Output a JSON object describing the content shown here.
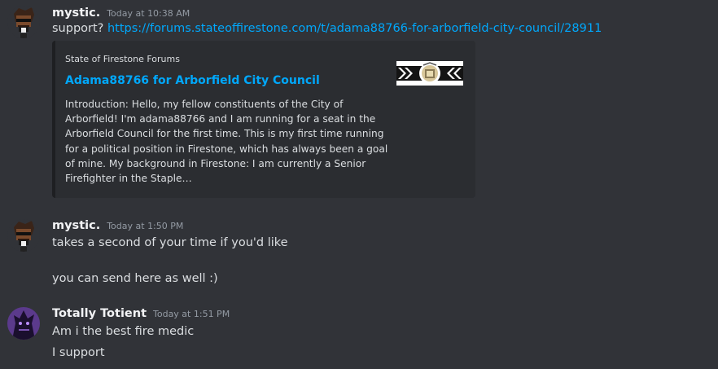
{
  "messages": [
    {
      "username": "mystic.",
      "timestamp": "Today at 10:38 AM",
      "text_prefix": "support?",
      "link": "https://forums.stateoffirestone.com/t/adama88766-for-arborfield-city-council/28911",
      "embed": {
        "provider": "State of Firestone Forums",
        "title": "Adama88766 for Arborfield City Council",
        "description": "Introduction: Hello, my fellow constituents of the City of\nArborfield! I'm adama88766 and I am running for a seat in the\nArborfield Council for the first time. This is my first time running\nfor a political position in Firestone, which has always been a goal\nof mine. My background in Firestone: I am currently a Senior\nFirefighter in the Staple…"
      }
    },
    {
      "username": "mystic.",
      "timestamp": "Today at 1:50 PM",
      "lines": [
        "takes a second of your time if you'd like",
        "you can send here as well :)"
      ]
    },
    {
      "username": "Totally Totient",
      "timestamp": "Today at 1:51 PM",
      "lines": [
        "Am i the best fire medic",
        "I support"
      ]
    }
  ],
  "colors": {
    "background": "#313338",
    "embed_background": "#2b2d31",
    "link": "#00a8fc",
    "username": "#f2f3f5",
    "timestamp": "#949ba4"
  }
}
